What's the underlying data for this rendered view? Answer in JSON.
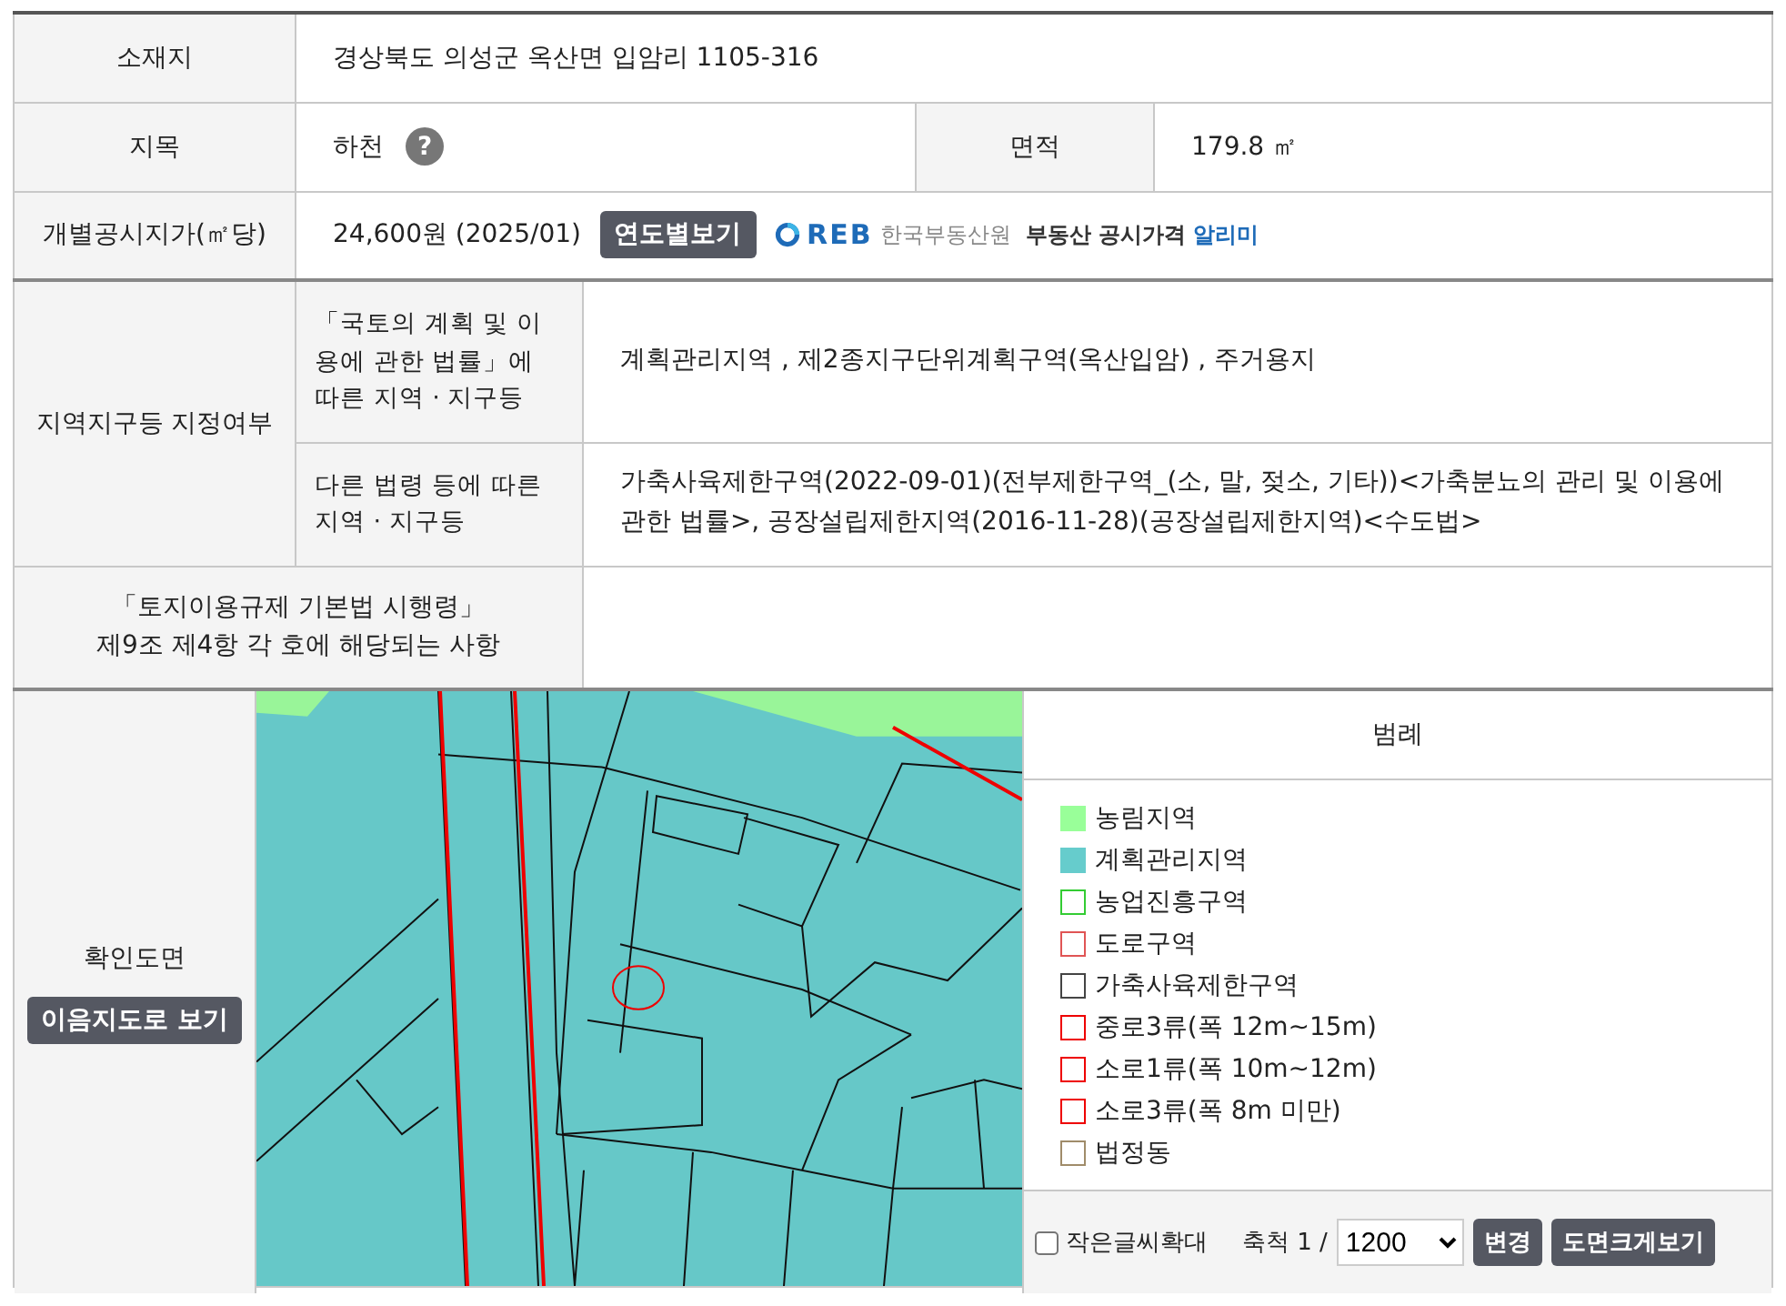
{
  "location": {
    "label": "소재지",
    "value": "경상북도 의성군 옥산면 입암리 1105-316"
  },
  "land_category": {
    "label": "지목",
    "value": "하천",
    "help": "?"
  },
  "area": {
    "label": "면적",
    "value": "179.8 ㎡"
  },
  "price": {
    "label": "개별공시지가(㎡당)",
    "value": "24,600원 (2025/01)",
    "button": "연도별보기",
    "logo_mark": "REB",
    "logo_org": "한국부동산원",
    "logo_service": "부동산 공시가격",
    "logo_service_highlight": "알리미"
  },
  "zoning": {
    "label": "지역지구등 지정여부",
    "rows": [
      {
        "label": "「국토의 계획 및 이용에 관한 법률」에 따른 지역 · 지구등",
        "value": "계획관리지역 , 제2종지구단위계획구역(옥산입암) , 주거용지"
      },
      {
        "label": "다른 법령 등에 따른 지역 · 지구등",
        "value": "가축사육제한구역(2022-09-01)(전부제한구역_(소, 말, 젖소, 기타))<가축분뇨의 관리 및 이용에 관한 법률>, 공장설립제한지역(2016-11-28)(공장설립제한지역)<수도법>"
      }
    ]
  },
  "regulation": {
    "label_lines": [
      "「토지이용규제 기본법 시행령」",
      "제9조 제4항 각 호에 해당되는 사항"
    ]
  },
  "map_section": {
    "label": "확인도면",
    "button": "이음지도로 보기",
    "legend_title": "범례",
    "legend": [
      {
        "label": "농림지역",
        "kind": "filled",
        "color": "#99ff99"
      },
      {
        "label": "계획관리지역",
        "kind": "filled",
        "color": "#66cccc"
      },
      {
        "label": "농업진흥구역",
        "kind": "outline",
        "color": "#33cc33"
      },
      {
        "label": "도로구역",
        "kind": "outline",
        "color": "#e05555"
      },
      {
        "label": "가축사육제한구역",
        "kind": "outline",
        "color": "#444444"
      },
      {
        "label": "중로3류(폭 12m~15m)",
        "kind": "outline",
        "color": "#ee0000"
      },
      {
        "label": "소로1류(폭 10m~12m)",
        "kind": "outline",
        "color": "#ee0000"
      },
      {
        "label": "소로3류(폭 8m 미만)",
        "kind": "outline",
        "color": "#ee0000"
      },
      {
        "label": "법정동",
        "kind": "outline",
        "color": "#a08c6a"
      }
    ],
    "enlarge": {
      "label": "작은글씨확대",
      "checked": false
    },
    "scale_label": "축척 1 /",
    "scale": "1200",
    "change_button": "변경",
    "large_button": "도면크게보기"
  }
}
